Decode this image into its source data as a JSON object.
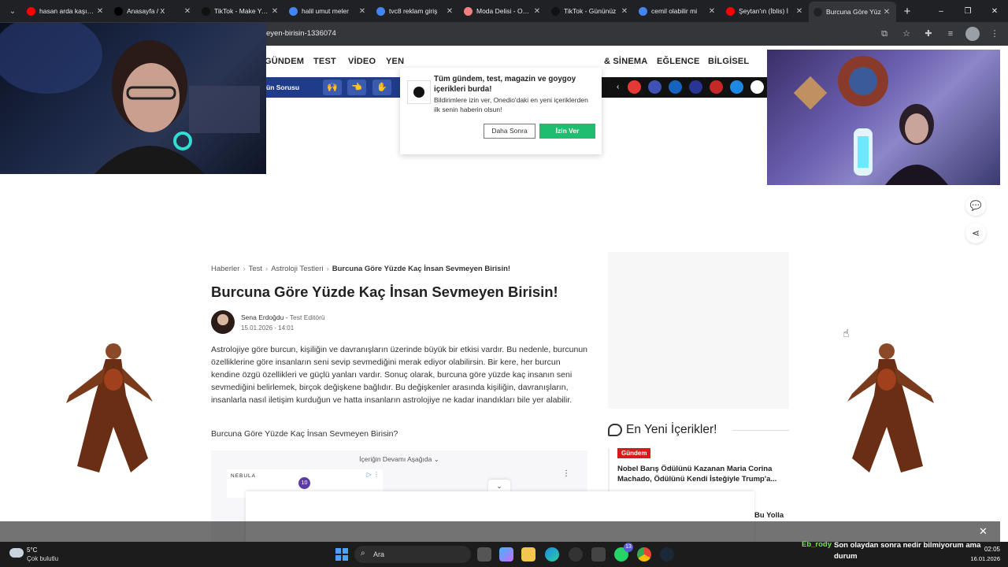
{
  "browser": {
    "tabs": [
      {
        "title": "hasan arda kaşıkçı",
        "color": "#ff0000"
      },
      {
        "title": "Anasayfa / X",
        "color": "#000000"
      },
      {
        "title": "TikTok - Make Your",
        "color": "#111111"
      },
      {
        "title": "halil umut meler",
        "color": "#4285f4"
      },
      {
        "title": "tvc8 reklam giriş",
        "color": "#4285f4"
      },
      {
        "title": "Moda Delisi - Oyun",
        "color": "#f08080"
      },
      {
        "title": "TikTok - Gününüz",
        "color": "#111111"
      },
      {
        "title": "cemil olabilir mi",
        "color": "#4285f4"
      },
      {
        "title": "Şeytan'ın (İblis) İ",
        "color": "#ff0000"
      },
      {
        "title": "Burcuna Göre Yüz",
        "color": "#222222"
      }
    ],
    "url": "eyen-birisin-1336074",
    "menu_icon": "chevron-down-icon",
    "new_tab": "+",
    "window_controls": [
      "–",
      "❐",
      "✕"
    ]
  },
  "site": {
    "nav": [
      "GÜNDEM",
      "TEST",
      "VİDEO",
      "YEN",
      "& SİNEMA",
      "EĞLENCE",
      "BİLGİSEL"
    ],
    "strip_label": "ün Sorusu"
  },
  "popup": {
    "title": "Tüm gündem, test, magazin ve goygoy içerikleri burda!",
    "body": "Bildirimlere izin ver, Onedio'daki en yeni içeriklerden ilk senin haberin olsun!",
    "later": "Daha Sonra",
    "allow": "İzin Ver"
  },
  "article": {
    "breadcrumb": [
      "Haberler",
      "Test",
      "Astroloji Testleri",
      "Burcuna Göre Yüzde Kaç İnsan Sevmeyen Birisin!"
    ],
    "title": "Burcuna Göre Yüzde Kaç İnsan Sevmeyen Birisin!",
    "author": "Sena Erdoğdu",
    "role": "Test Editörü",
    "date": "15.01.2026 - 14:01",
    "paragraph": "Astrolojiye göre burcun, kişiliğin ve davranışların üzerinde büyük bir etkisi vardır. Bu nedenle, burcunun özelliklerine göre insanların seni sevip sevmediğini merak ediyor olabilirsin. Bir kere, her burcun kendine özgü özellikleri ve güçlü yanları vardır. Sonuç olarak, burcuna göre yüzde kaç insanın seni sevmediğini belirlemek, birçok değişkene bağlıdır. Bu değişkenler arasında kişiliğin, davranışların, insanlarla nasıl iletişim kurduğun ve hatta insanların astrolojiye ne kadar inandıkları bile yer alabilir.",
    "question": "Burcuna Göre Yüzde Kaç İnsan Sevmeyen Birisin?",
    "continue": "İçeriğin Devamı Aşağıda",
    "ad_brand": "NEBULA",
    "ad_badge": "10"
  },
  "sidebar": {
    "newest_title": "En Yeni İçerikler!",
    "tag": "Gündem",
    "news1": "Nobel Barış Ödülünü Kazanan Maria Corina Machado, Ödülünü Kendi İsteğiyle Trump'a...",
    "news2": "Bu Yolla"
  },
  "taskbar": {
    "temp": "5°C",
    "condition": "Çok bulutlu",
    "search": "Ara",
    "time": "02:05",
    "date": "16.01.2026",
    "whatsapp_badge": "13"
  },
  "chat": {
    "user": "Eb_rody",
    "message": "Son olaydan sonra nedir bilmiyorum ama durum"
  }
}
